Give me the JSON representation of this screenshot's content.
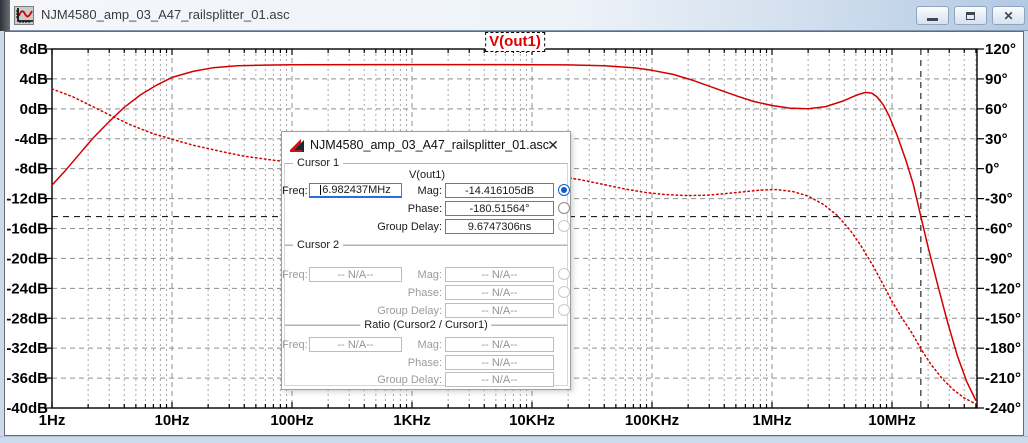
{
  "window": {
    "title": "NJM4580_amp_03_A47_railsplitter_01.asc",
    "close_glyph": "✕"
  },
  "plot": {
    "trace_label": "V(out1)"
  },
  "chart_data": {
    "type": "line",
    "title": "V(out1)",
    "x_axis": {
      "scale": "log",
      "unit": "Hz",
      "min_hz": 1,
      "max_hz": 51000000,
      "tick_labels": [
        "1Hz",
        "10Hz",
        "100Hz",
        "1KHz",
        "10KHz",
        "100KHz",
        "1MHz",
        "10MHz"
      ]
    },
    "y_left_axis": {
      "unit": "dB",
      "min": -40,
      "max": 8,
      "step": 4,
      "tick_labels": [
        "8dB",
        "4dB",
        "0dB",
        "-4dB",
        "-8dB",
        "-12dB",
        "-16dB",
        "-20dB",
        "-24dB",
        "-28dB",
        "-32dB",
        "-36dB",
        "-40dB"
      ]
    },
    "y_right_axis": {
      "unit": "°",
      "min": -240,
      "max": 120,
      "step": 30,
      "tick_labels": [
        "120°",
        "90°",
        "60°",
        "30°",
        "0°",
        "-30°",
        "-60°",
        "-90°",
        "-120°",
        "-150°",
        "-180°",
        "-210°",
        "-240°"
      ]
    },
    "trace_color": "#d40000",
    "series": [
      {
        "name": "V(out1) magnitude",
        "axis": "left",
        "style": "solid",
        "points": [
          [
            1,
            -10.2
          ],
          [
            1.3,
            -8.2
          ],
          [
            1.7,
            -6.0
          ],
          [
            2.2,
            -3.9
          ],
          [
            3,
            -1.7
          ],
          [
            4,
            0.2
          ],
          [
            5.5,
            1.9
          ],
          [
            7.5,
            3.2
          ],
          [
            10,
            4.2
          ],
          [
            15,
            5.0
          ],
          [
            22,
            5.5
          ],
          [
            35,
            5.75
          ],
          [
            60,
            5.85
          ],
          [
            100,
            5.9
          ],
          [
            1000,
            5.92
          ],
          [
            10000,
            5.9
          ],
          [
            20000,
            5.87
          ],
          [
            40000,
            5.75
          ],
          [
            70000,
            5.5
          ],
          [
            100000,
            5.15
          ],
          [
            150000,
            4.6
          ],
          [
            220000,
            3.8
          ],
          [
            330000,
            2.8
          ],
          [
            500000,
            1.75
          ],
          [
            700000,
            1.0
          ],
          [
            1000000,
            0.45
          ],
          [
            1400000,
            0.1
          ],
          [
            2000000,
            0.0
          ],
          [
            2800000,
            0.3
          ],
          [
            4000000,
            1.1
          ],
          [
            5000000,
            1.8
          ],
          [
            6000000,
            2.2
          ],
          [
            6800000,
            2.1
          ],
          [
            7500000,
            1.6
          ],
          [
            8500000,
            0.5
          ],
          [
            9500000,
            -1.0
          ],
          [
            11000000,
            -3.5
          ],
          [
            13000000,
            -6.8
          ],
          [
            15000000,
            -10.0
          ],
          [
            17400000,
            -14.42
          ],
          [
            20000000,
            -18.5
          ],
          [
            24000000,
            -23.5
          ],
          [
            29000000,
            -28.5
          ],
          [
            35000000,
            -33.0
          ],
          [
            42000000,
            -36.5
          ],
          [
            50000000,
            -39.0
          ]
        ]
      },
      {
        "name": "V(out1) phase",
        "axis": "right",
        "style": "dotted",
        "points": [
          [
            1,
            80
          ],
          [
            1.5,
            72
          ],
          [
            2,
            64.5
          ],
          [
            3,
            54
          ],
          [
            4.5,
            44
          ],
          [
            7,
            35
          ],
          [
            10,
            29.5
          ],
          [
            15,
            23.5
          ],
          [
            25,
            17.5
          ],
          [
            40,
            12.5
          ],
          [
            70,
            8.5
          ],
          [
            120,
            5.5
          ],
          [
            300,
            2.5
          ],
          [
            1000,
            0.5
          ],
          [
            3000,
            -1.5
          ],
          [
            8000,
            -4
          ],
          [
            15000,
            -7
          ],
          [
            25000,
            -11
          ],
          [
            40000,
            -16
          ],
          [
            60000,
            -20.5
          ],
          [
            90000,
            -24
          ],
          [
            130000,
            -26
          ],
          [
            200000,
            -27
          ],
          [
            300000,
            -26.5
          ],
          [
            500000,
            -24
          ],
          [
            800000,
            -21.5
          ],
          [
            1100000,
            -21
          ],
          [
            1500000,
            -23
          ],
          [
            2000000,
            -27.5
          ],
          [
            2700000,
            -36
          ],
          [
            3500000,
            -47
          ],
          [
            4500000,
            -62
          ],
          [
            5500000,
            -77
          ],
          [
            7000000,
            -98
          ],
          [
            8500000,
            -117
          ],
          [
            10000000,
            -133
          ],
          [
            12000000,
            -149
          ],
          [
            14500000,
            -164
          ],
          [
            17400000,
            -180.5
          ],
          [
            21000000,
            -196
          ],
          [
            26000000,
            -210
          ],
          [
            32000000,
            -221
          ],
          [
            40000000,
            -230
          ],
          [
            50000000,
            -236
          ]
        ]
      }
    ],
    "cursor_crosshair": {
      "mag_db": -14.416105,
      "x_hz": 17400000
    }
  },
  "dialog": {
    "title": "NJM4580_amp_03_A47_railsplitter_01.asc",
    "close_glyph": "✕",
    "cursor1": {
      "legend": "Cursor 1",
      "trace": "V(out1)",
      "freq_label": "Freq:",
      "freq_value": "6.982437MHz",
      "mag_label": "Mag:",
      "mag_value": "-14.416105dB",
      "phase_label": "Phase:",
      "phase_value": "-180.51564°",
      "group_delay_label": "Group Delay:",
      "group_delay_value": "9.6747306ns"
    },
    "cursor2": {
      "legend": "Cursor 2",
      "freq_label": "Freq:",
      "freq_value": "-- N/A--",
      "mag_label": "Mag:",
      "mag_value": "-- N/A--",
      "phase_label": "Phase:",
      "phase_value": "-- N/A--",
      "group_delay_label": "Group Delay:",
      "group_delay_value": "-- N/A--"
    },
    "ratio": {
      "legend": "Ratio (Cursor2 / Cursor1)",
      "freq_label": "Freq:",
      "freq_value": "-- N/A--",
      "mag_label": "Mag:",
      "mag_value": "-- N/A--",
      "phase_label": "Phase:",
      "phase_value": "-- N/A--",
      "group_delay_label": "Group Delay:",
      "group_delay_value": "-- N/A--"
    }
  }
}
